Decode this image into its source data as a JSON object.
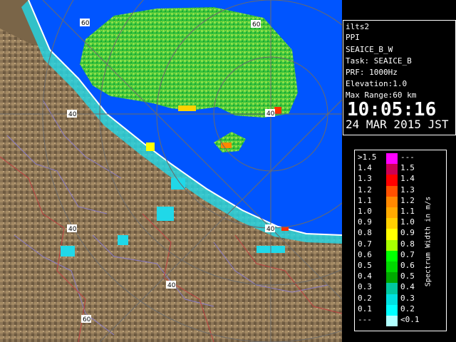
{
  "info": {
    "site": "ilts2",
    "mode": "PPI",
    "scan": "SEAICE_B_W",
    "task": "Task: SEAICE_B",
    "prf": "PRF: 1000Hz",
    "elevation": "Elevation:1.0",
    "max_range": "Max Range:60 km",
    "time": "10:05:16",
    "date": "24 MAR 2015 JST"
  },
  "legend": {
    "title": "Spectrum Width in m/s",
    "left_labels": [
      ">1.5",
      "1.4",
      "1.3",
      "1.2",
      "1.1",
      "1.0",
      "0.9",
      "0.8",
      "0.7",
      "0.6",
      "0.5",
      "0.4",
      "0.3",
      "0.2",
      "0.1",
      "---"
    ],
    "right_labels": [
      "---",
      "1.5",
      "1.4",
      "1.3",
      "1.2",
      "1.1",
      "1.0",
      "0.9",
      "0.8",
      "0.7",
      "0.6",
      "0.5",
      "0.4",
      "0.3",
      "0.2",
      "<0.1"
    ],
    "colors": [
      "#ff00ff",
      "#cc0055",
      "#ff0000",
      "#ff5000",
      "#ff8800",
      "#ffaa00",
      "#ffd000",
      "#ffff00",
      "#a8ff00",
      "#00ff00",
      "#00d800",
      "#00a800",
      "#00c8a0",
      "#00e0e0",
      "#00ffff",
      "#b0ffff"
    ]
  },
  "map": {
    "ring_labels": [
      "60",
      "60",
      "40",
      "40",
      "40",
      "40",
      "40",
      "60"
    ],
    "colors": {
      "sea": "#0055ff",
      "land": "#8c7556",
      "coast": "#ffffff",
      "ring": "#6a6a6a",
      "echo": "#44cc44"
    }
  }
}
